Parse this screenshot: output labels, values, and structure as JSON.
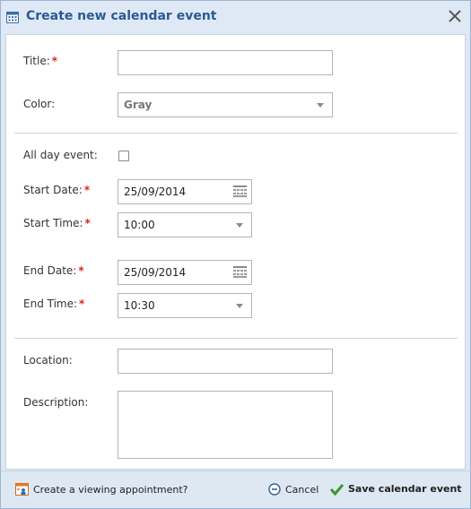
{
  "dialog": {
    "title": "Create new calendar event",
    "title_icon": "calendar-icon",
    "close_icon": "close-icon"
  },
  "form": {
    "title": {
      "label": "Title:",
      "required_mark": "*",
      "value": ""
    },
    "color": {
      "label": "Color:",
      "value": "Gray"
    },
    "all_day": {
      "label": "All day event:",
      "checked": false
    },
    "start_date": {
      "label": "Start Date:",
      "required_mark": "*",
      "value": "25/09/2014"
    },
    "start_time": {
      "label": "Start Time:",
      "required_mark": "*",
      "value": "10:00"
    },
    "end_date": {
      "label": "End Date:",
      "required_mark": "*",
      "value": "25/09/2014"
    },
    "end_time": {
      "label": "End Time:",
      "required_mark": "*",
      "value": "10:30"
    },
    "location": {
      "label": "Location:",
      "value": ""
    },
    "description": {
      "label": "Description:",
      "value": ""
    }
  },
  "footer": {
    "viewing_link": "Create a viewing appointment?",
    "cancel": "Cancel",
    "save": "Save calendar event"
  },
  "colors": {
    "title_text": "#2a5a96",
    "required": "#d9251d",
    "save_check": "#3a9a2a",
    "header_bg": "#dfe9f5"
  }
}
